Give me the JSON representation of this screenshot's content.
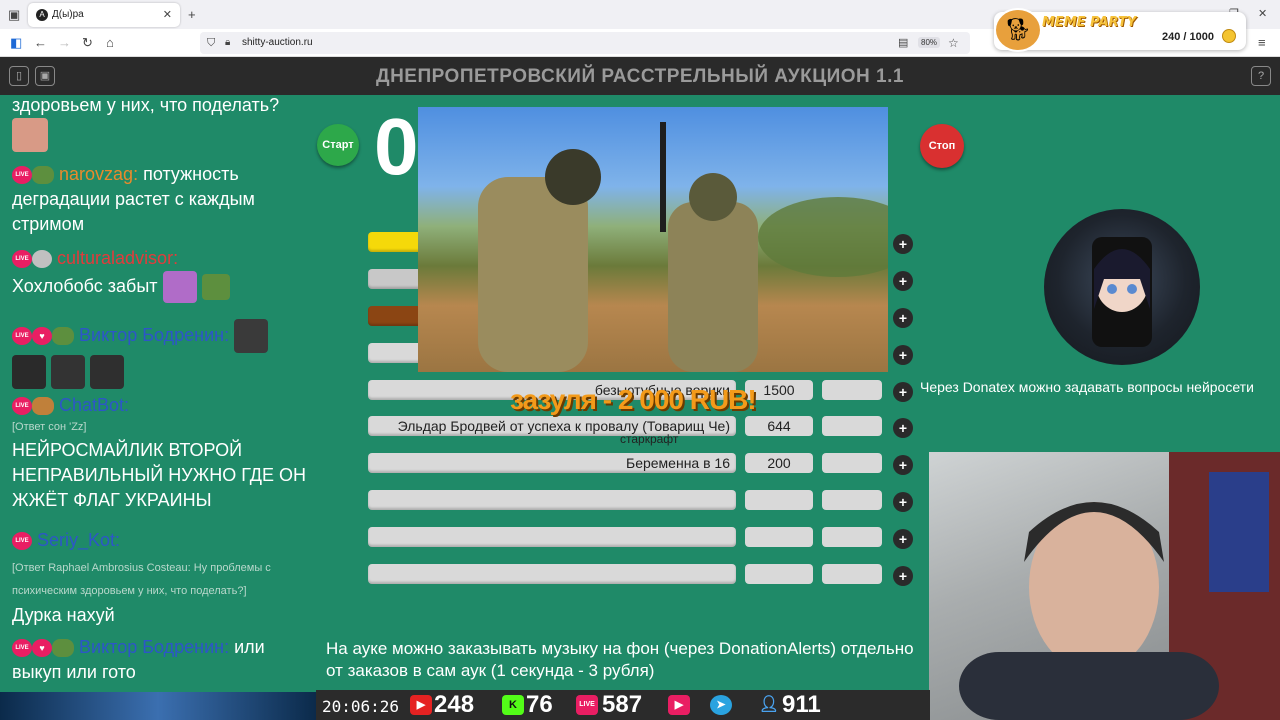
{
  "browser": {
    "tab_title": "Д(ы)ра",
    "url": "shitty-auction.ru",
    "zoom": "80%"
  },
  "overlay": {
    "brand": "MEME PARTY",
    "score": "240 / 1000"
  },
  "site": {
    "title": "ДНЕПРОПЕТРОВСКИЙ РАССТРЕЛЬНЫЙ АУКЦИОН 1.1",
    "help": "?"
  },
  "chat": {
    "m0": "здоровьем у них, что поделать?",
    "m1_user": "narovzag:",
    "m1_text": "потужность деградации растет с каждым стримом",
    "m2_user": "culturaladvisor:",
    "m2_text": "Хохлобобс забыт",
    "m3_user": "Виктор Бодренин:",
    "m4_user": "ChatBot:",
    "m4_reply": "[Ответ сон 'Zz]",
    "m4_text": "НЕЙРОСМАЙЛИК ВТОРОЙ НЕПРАВИЛЬНЫЙ НУЖНО ГДЕ ОН ЖЖЁТ ФЛАГ УКРАИНЫ",
    "m5_user": "Seriy_Kot:",
    "m5_reply": "[Ответ Raphael Ambrosius Costeau: Ну проблемы с психическим здоровьем у них, что поделать?]",
    "m5_text": "Дурка нахуй",
    "m6_user": "Виктор Бодренин:",
    "m6_text": "или выкуп или гото",
    "live": "LIVE"
  },
  "controls": {
    "start": "Старт",
    "stop": "Стоп",
    "timer": "0"
  },
  "lots": [
    {
      "name": "",
      "amount": "",
      "color": "#f5d90a"
    },
    {
      "name": "",
      "amount": "",
      "color": "#c8c8c8"
    },
    {
      "name": "",
      "amount": "",
      "color": "#8b4513"
    },
    {
      "name": "",
      "amount": "",
      "color": "#d9d9d9"
    },
    {
      "name": "безьютубные ворики",
      "amount": "1500",
      "color": "#d9d9d9"
    },
    {
      "name": "Эльдар Бродвей от успеха к провалу (Товарищ Че)",
      "amount": "644",
      "color": "#d9d9d9"
    },
    {
      "name": "Беременна в 16",
      "amount": "200",
      "color": "#d9d9d9"
    },
    {
      "name": "",
      "amount": "",
      "color": "#d9d9d9"
    },
    {
      "name": "",
      "amount": "",
      "color": "#d9d9d9"
    },
    {
      "name": "",
      "amount": "",
      "color": "#d9d9d9"
    }
  ],
  "plus_label": "+",
  "donation": {
    "text": "зазуля - 2 000 RUB!",
    "name": "старкрафт"
  },
  "ticker": "Через Donatex можно задавать вопросы нейросети",
  "notes": "На ауке можно заказывать музыку на фон (через DonationAlerts) отдельно от заказов в сам аук (1 секунда - 3 рубля)",
  "stats": {
    "clock": "20:06:26",
    "youtube": "248",
    "kick": "76",
    "vk": "587",
    "telegram_label": "",
    "viewers": "911"
  },
  "colors": {
    "page_bg": "#1f8a68",
    "header_bg": "#2a2a2a",
    "start": "#2da84a",
    "stop": "#d93030",
    "donation": "#f39a1a"
  }
}
